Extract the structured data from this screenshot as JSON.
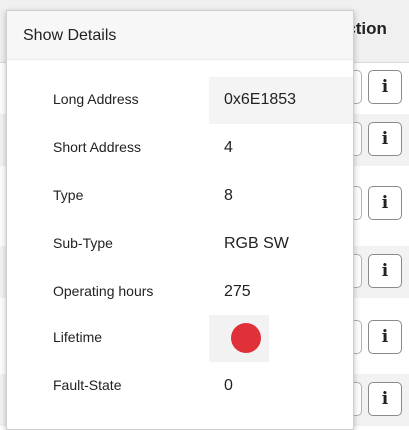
{
  "background_table": {
    "column_header": "Action",
    "row_buttons": [
      "i",
      "i",
      "i",
      "i",
      "i",
      "i"
    ]
  },
  "popover": {
    "title": "Show Details",
    "details": [
      {
        "label": "Long Address",
        "value": "0x6E1853"
      },
      {
        "label": "Short Address",
        "value": "4"
      },
      {
        "label": "Type",
        "value": "8"
      },
      {
        "label": "Sub-Type",
        "value": "RGB SW"
      },
      {
        "label": "Operating hours",
        "value": "275"
      },
      {
        "label": "Lifetime",
        "indicator": "red-dot",
        "indicator_color": "#e0303a"
      },
      {
        "label": "Fault-State",
        "value": "0"
      }
    ]
  },
  "colors": {
    "status_red": "#e0303a",
    "header_bg": "#f0f0f0"
  }
}
